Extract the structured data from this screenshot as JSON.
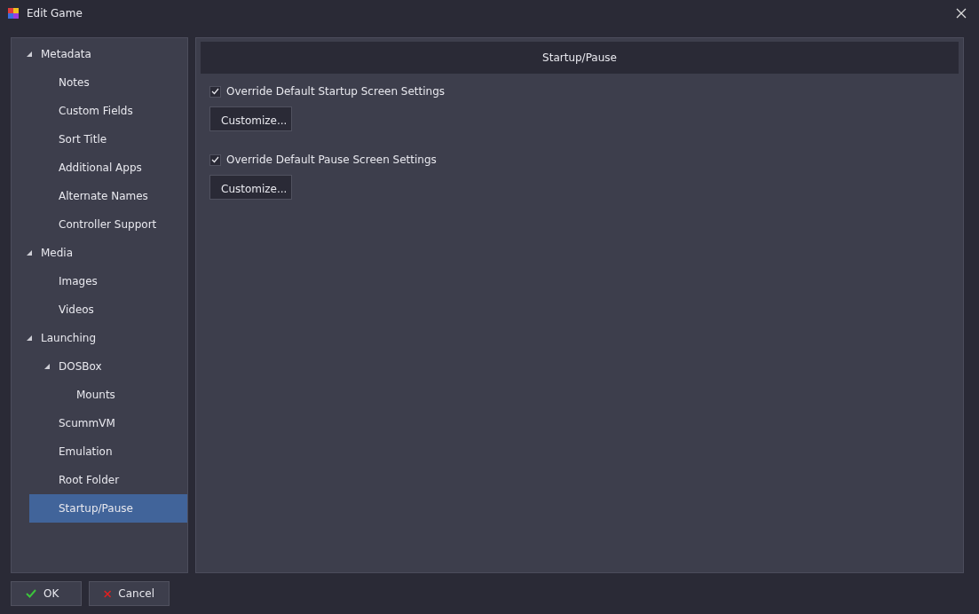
{
  "window": {
    "title": "Edit Game"
  },
  "sidebar": {
    "items": [
      {
        "label": "Metadata",
        "expanded": true,
        "selected": false,
        "children": [
          {
            "label": "Notes",
            "selected": false
          },
          {
            "label": "Custom Fields",
            "selected": false
          },
          {
            "label": "Sort Title",
            "selected": false
          },
          {
            "label": "Additional Apps",
            "selected": false
          },
          {
            "label": "Alternate Names",
            "selected": false
          },
          {
            "label": "Controller Support",
            "selected": false
          }
        ]
      },
      {
        "label": "Media",
        "expanded": true,
        "selected": false,
        "children": [
          {
            "label": "Images",
            "selected": false
          },
          {
            "label": "Videos",
            "selected": false
          }
        ]
      },
      {
        "label": "Launching",
        "expanded": true,
        "selected": false,
        "children": [
          {
            "label": "DOSBox",
            "expanded": true,
            "selected": false,
            "children": [
              {
                "label": "Mounts",
                "selected": false
              }
            ]
          },
          {
            "label": "ScummVM",
            "selected": false
          },
          {
            "label": "Emulation",
            "selected": false
          },
          {
            "label": "Root Folder",
            "selected": false
          },
          {
            "label": "Startup/Pause",
            "selected": true
          }
        ]
      }
    ]
  },
  "panel": {
    "header": "Startup/Pause",
    "options": [
      {
        "label": "Override Default Startup Screen Settings",
        "checked": true,
        "button": "Customize..."
      },
      {
        "label": "Override Default Pause Screen Settings",
        "checked": true,
        "button": "Customize..."
      }
    ]
  },
  "buttons": [
    {
      "label": "OK",
      "kind": "ok"
    },
    {
      "label": "Cancel",
      "kind": "cancel"
    }
  ]
}
